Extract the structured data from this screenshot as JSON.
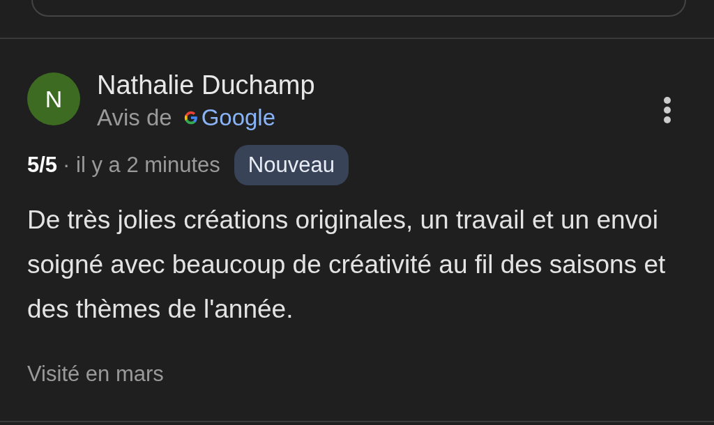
{
  "review": {
    "author": "Nathalie Duchamp",
    "avatar_initial": "N",
    "source_prefix": "Avis de",
    "source": "Google",
    "rating": "5/5",
    "separator": "·",
    "time": "il y a 2 minutes",
    "badge": "Nouveau",
    "text": "De très jolies créations originales, un travail et un envoi soigné avec beaucoup de créativité au fil des saisons et des thèmes de l'année.",
    "visited": "Visité en mars"
  }
}
